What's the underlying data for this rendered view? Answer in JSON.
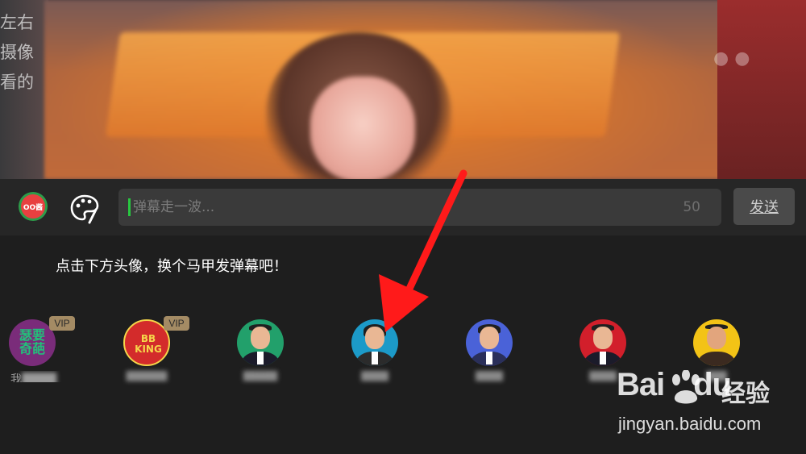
{
  "video": {
    "scroll_lines": [
      "左右",
      "摄像",
      "看的"
    ]
  },
  "input_bar": {
    "identity_badge": "OO酱",
    "placeholder": "弹幕走一波...",
    "char_limit": "50",
    "send_label": "发送"
  },
  "panel": {
    "hint": "点击下方头像，换个马甲发弹幕吧！",
    "vip_label": "VIP",
    "avatars": [
      {
        "id": "a1",
        "badge_text": "瑟要\n奇葩",
        "vip": true,
        "name": "我",
        "color": "#7a2c7a"
      },
      {
        "id": "a2",
        "badge_text": "BB\nKING",
        "vip": true,
        "name": "",
        "color": "#d32b2b"
      },
      {
        "id": "a3",
        "vip": false,
        "name": "",
        "color": "#22a06b"
      },
      {
        "id": "a4",
        "vip": false,
        "name": "",
        "color": "#1c9ac8"
      },
      {
        "id": "a5",
        "vip": false,
        "name": "",
        "color": "#4a62d8"
      },
      {
        "id": "a6",
        "vip": false,
        "name": "",
        "color": "#d21f2b"
      },
      {
        "id": "a7",
        "vip": false,
        "name": "",
        "color": "#f3c316"
      }
    ]
  },
  "watermark": {
    "logo": "Bai",
    "logo_suffix": "du",
    "cn": "经验",
    "url": "jingyan.baidu.com"
  },
  "colors": {
    "accent_green": "#28c840",
    "arrow_red": "#ff1a1a",
    "vip_gold": "#a48b64"
  }
}
